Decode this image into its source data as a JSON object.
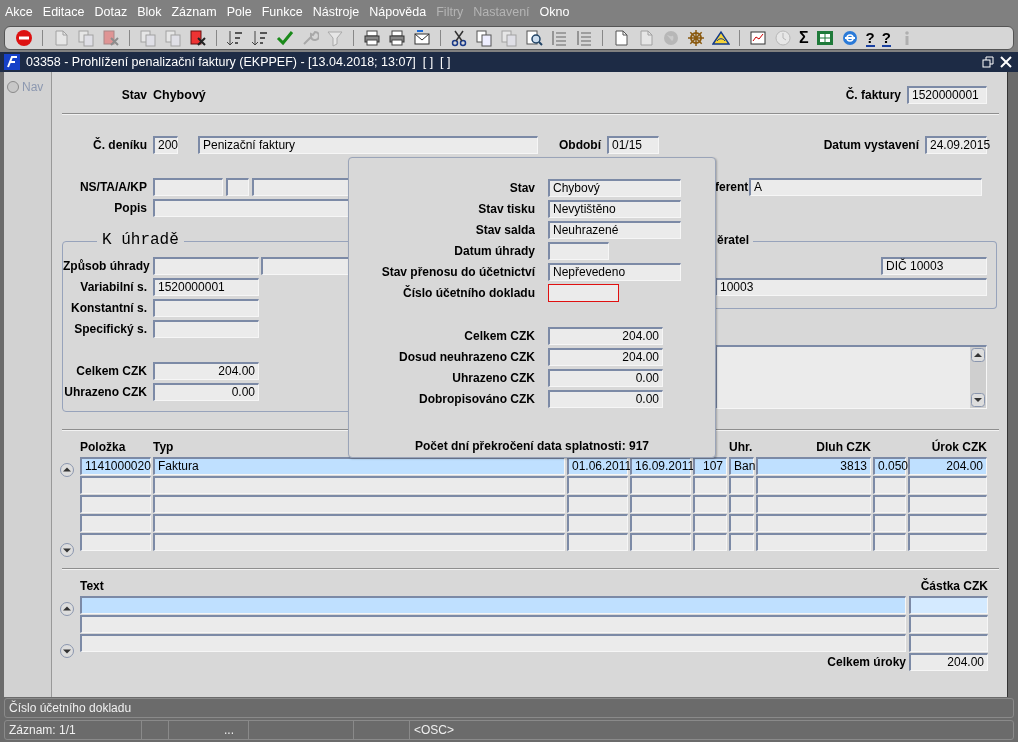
{
  "menu": [
    {
      "label": "Akce",
      "disabled": false
    },
    {
      "label": "Editace",
      "disabled": false
    },
    {
      "label": "Dotaz",
      "disabled": false
    },
    {
      "label": "Blok",
      "disabled": false
    },
    {
      "label": "Záznam",
      "disabled": false
    },
    {
      "label": "Pole",
      "disabled": false
    },
    {
      "label": "Funkce",
      "disabled": false
    },
    {
      "label": "Nástroje",
      "disabled": false
    },
    {
      "label": "Nápověda",
      "disabled": false
    },
    {
      "label": "Filtry",
      "disabled": true
    },
    {
      "label": "Nastavení",
      "disabled": true
    },
    {
      "label": "Okno",
      "disabled": false
    }
  ],
  "toolbar": [
    {
      "kind": "exit",
      "disabled": false
    },
    {
      "kind": "sep"
    },
    {
      "kind": "doc",
      "disabled": true
    },
    {
      "kind": "docs",
      "disabled": true
    },
    {
      "kind": "delete",
      "disabled": true
    },
    {
      "kind": "sep"
    },
    {
      "kind": "docs",
      "disabled": true
    },
    {
      "kind": "docs",
      "disabled": true
    },
    {
      "kind": "delete",
      "disabled": false
    },
    {
      "kind": "sep"
    },
    {
      "kind": "sort",
      "disabled": false
    },
    {
      "kind": "sort",
      "disabled": false
    },
    {
      "kind": "check",
      "disabled": false
    },
    {
      "kind": "wrench",
      "disabled": true
    },
    {
      "kind": "filter",
      "disabled": true
    },
    {
      "kind": "sep"
    },
    {
      "kind": "print",
      "disabled": false
    },
    {
      "kind": "print",
      "disabled": false
    },
    {
      "kind": "mail",
      "disabled": false
    },
    {
      "kind": "sep"
    },
    {
      "kind": "scissors",
      "disabled": false
    },
    {
      "kind": "docs",
      "disabled": false
    },
    {
      "kind": "docs",
      "disabled": true
    },
    {
      "kind": "search",
      "disabled": false
    },
    {
      "kind": "list",
      "disabled": false
    },
    {
      "kind": "list",
      "disabled": false
    },
    {
      "kind": "sep"
    },
    {
      "kind": "doc",
      "disabled": false
    },
    {
      "kind": "doc",
      "disabled": true
    },
    {
      "kind": "globe",
      "disabled": true
    },
    {
      "kind": "wheel",
      "disabled": false
    },
    {
      "kind": "triangle",
      "disabled": false
    },
    {
      "kind": "sep"
    },
    {
      "kind": "chart",
      "disabled": false
    },
    {
      "kind": "clock",
      "disabled": true
    },
    {
      "kind": "sum",
      "label": "Σ",
      "disabled": false
    },
    {
      "kind": "sheet",
      "disabled": false
    },
    {
      "kind": "browser",
      "disabled": false
    },
    {
      "kind": "help",
      "label": "?",
      "disabled": false
    },
    {
      "kind": "help",
      "label": "?",
      "disabled": false
    },
    {
      "kind": "info",
      "disabled": true
    }
  ],
  "window": {
    "title": "03358 - Prohlížení penalizační faktury (EKPPEF) - [13.04.2018; 13:07]  [ ]  [ ]"
  },
  "nav": {
    "label": "Nav",
    "disabled": true
  },
  "header": {
    "stav": {
      "label": "Stav",
      "value": "Chybový"
    },
    "invoice": {
      "label": "Č. faktury",
      "value": "1520000001"
    }
  },
  "journal": {
    "label": "Č. deníku",
    "code": "200",
    "name": "Penizační faktury"
  },
  "period": {
    "label": "Období",
    "value": "01/15"
  },
  "issue_date": {
    "label": "Datum vystavení",
    "value": "24.09.2015"
  },
  "ns": {
    "label": "NS/TA/A/KP"
  },
  "popis": {
    "label": "Popis"
  },
  "referent": {
    "label": "ferent",
    "value": "A"
  },
  "payment": {
    "title": "K úhradě",
    "fields": [
      {
        "label": "Způsob úhrady"
      },
      {
        "label": "Variabilní s.",
        "value": "1520000001"
      },
      {
        "label": "Konstantní s."
      },
      {
        "label": "Specifický s."
      }
    ],
    "totals": [
      {
        "label": "Celkem CZK",
        "value": "204.00"
      },
      {
        "label": "Uhrazeno CZK",
        "value": "0.00"
      }
    ]
  },
  "customer": {
    "title": "ěratel",
    "dic": "DIČ 10003",
    "name": "10003"
  },
  "items": {
    "columns": [
      "Položka",
      "Typ",
      "Uhr.",
      "Dluh CZK",
      "Úrok CZK"
    ],
    "rows": [
      {
        "selected": true,
        "cells": [
          "1141000020",
          "Faktura",
          "01.06.2011",
          "16.09.2011",
          "107",
          "Ban",
          "3813",
          "0.050",
          "204.00"
        ]
      },
      {
        "selected": false
      },
      {
        "selected": false
      },
      {
        "selected": false
      },
      {
        "selected": false
      }
    ]
  },
  "texts": {
    "columns": [
      "Text",
      "Částka CZK"
    ],
    "rows": [
      {
        "selected": true
      },
      {
        "selected": false
      },
      {
        "selected": false
      }
    ],
    "total": {
      "label": "Celkem úroky",
      "value": "204.00"
    }
  },
  "dialog": {
    "fields": [
      {
        "label": "Stav",
        "value": "Chybový",
        "focused": false
      },
      {
        "label": "Stav tisku",
        "value": "Nevytištěno",
        "focused": false
      },
      {
        "label": "Stav salda",
        "value": "Neuhrazené",
        "focused": false
      },
      {
        "label": "Datum úhrady",
        "focused": false
      },
      {
        "label": "Stav přenosu do účetnictví",
        "value": "Nepřevedeno",
        "focused": false
      },
      {
        "label": "Číslo účetního dokladu",
        "focused": true
      }
    ],
    "amounts": [
      {
        "label": "Celkem CZK",
        "value": "204.00"
      },
      {
        "label": "Dosud neuhrazeno CZK",
        "value": "204.00"
      },
      {
        "label": "Uhrazeno CZK",
        "value": "0.00"
      },
      {
        "label": "Dobropisováno CZK",
        "value": "0.00"
      }
    ],
    "note": "Počet dní překročení data splatnosti: 917"
  },
  "status": {
    "message": "Číslo účetního dokladu",
    "record": "Záznam: 1/1",
    "more": "...",
    "mode": "<OSC>"
  }
}
